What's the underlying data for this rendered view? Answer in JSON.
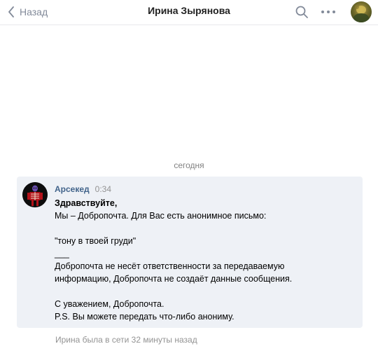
{
  "header": {
    "back_label": "Назад",
    "title": "Ирина Зырянова",
    "icons": {
      "back": "chevron-left-icon",
      "search": "search-icon",
      "more": "more-dots-icon"
    }
  },
  "conversation": {
    "date_separator": "сегодня",
    "message": {
      "author": "Арсекед",
      "time": "0:34",
      "lines": [
        "Здравствуйте,",
        "Мы – Добропочта. Для Вас есть анонимное письмо:",
        "",
        "\"тону в твоей груди\"",
        "___",
        "Добропочта не несёт ответственности за передаваемую",
        "информацию, Добропочта не создаёт данные сообщения.",
        "",
        "С уважением, Добропочта.",
        "P.S. Вы можете передать что-либо анониму."
      ]
    },
    "status": "Ирина была в сети 32 минуты назад"
  },
  "colors": {
    "accent": "#42648b",
    "muted": "#828a99",
    "message_bg": "#eef1f6",
    "divider": "#e7e8ec"
  }
}
